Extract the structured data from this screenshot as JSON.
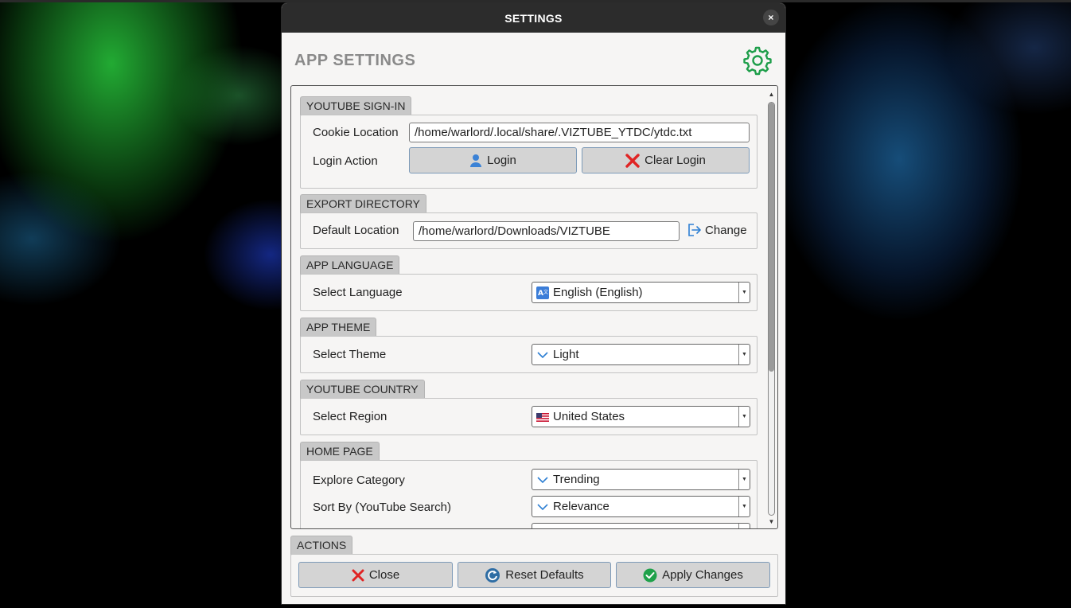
{
  "window": {
    "title": "SETTINGS",
    "close_glyph": "×"
  },
  "header": {
    "title": "APP SETTINGS",
    "icon": "gear-icon",
    "accent_color": "#1e9e4a"
  },
  "sections": {
    "youtube_signin": {
      "title": "YOUTUBE SIGN-IN",
      "cookie_label": "Cookie Location",
      "cookie_value": "/home/warlord/.local/share/.VIZTUBE_YTDC/ytdc.txt",
      "login_action_label": "Login Action",
      "login_button": "Login",
      "clear_login_button": "Clear Login"
    },
    "export_directory": {
      "title": "EXPORT DIRECTORY",
      "default_location_label": "Default Location",
      "default_location_value": "/home/warlord/Downloads/VIZTUBE",
      "change_button": "Change"
    },
    "app_language": {
      "title": "APP LANGUAGE",
      "label": "Select Language",
      "value": "English (English)"
    },
    "app_theme": {
      "title": "APP THEME",
      "label": "Select Theme",
      "value": "Light"
    },
    "youtube_country": {
      "title": "YOUTUBE COUNTRY",
      "label": "Select Region",
      "value": "United States"
    },
    "home_page": {
      "title": "HOME PAGE",
      "explore_label": "Explore Category",
      "explore_value": "Trending",
      "sort_label": "Sort By (YouTube Search)",
      "sort_value": "Relevance"
    }
  },
  "actions": {
    "title": "ACTIONS",
    "close_button": "Close",
    "reset_button": "Reset Defaults",
    "apply_button": "Apply Changes"
  },
  "scrollbar": {
    "position_fraction": 0.0
  }
}
